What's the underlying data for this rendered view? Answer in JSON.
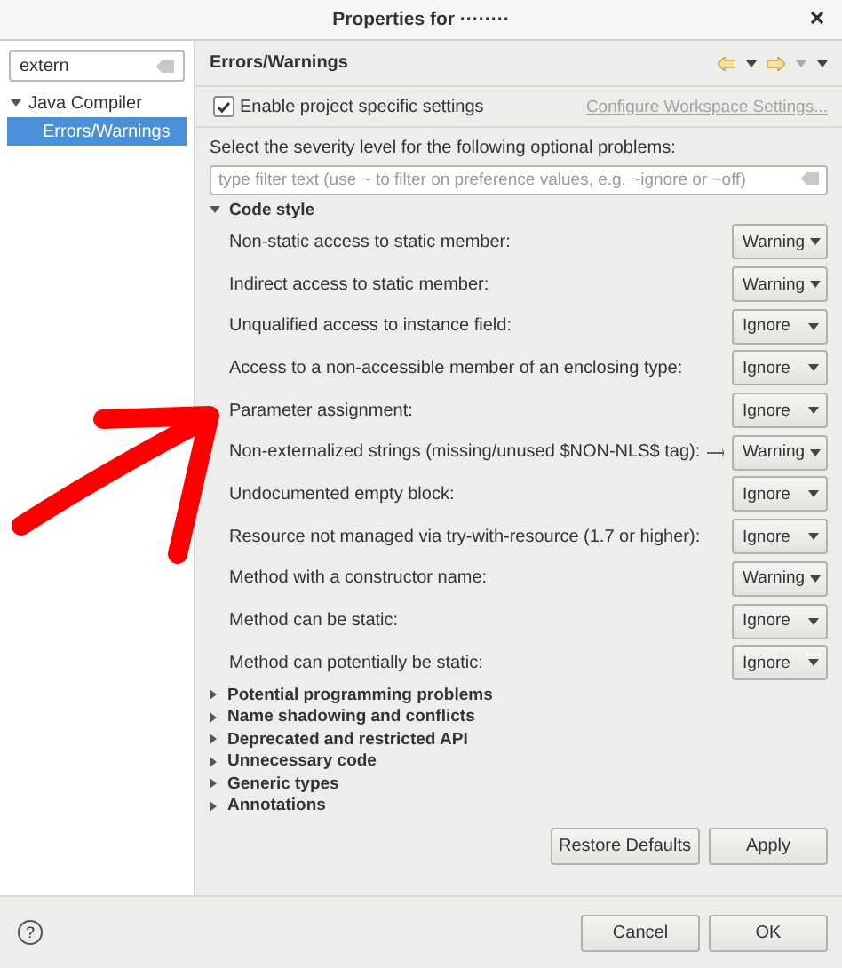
{
  "window": {
    "title": "Properties for ········"
  },
  "sidebar": {
    "filter": {
      "value": "extern"
    },
    "items": [
      {
        "label": "Java Compiler",
        "expanded": true,
        "selected": false,
        "children": [
          {
            "label": "Errors/Warnings",
            "selected": true
          }
        ]
      }
    ]
  },
  "page": {
    "title": "Errors/Warnings",
    "enable": {
      "label": "Enable project specific settings",
      "checked": true
    },
    "configure_link": "Configure Workspace Settings...",
    "description": "Select the severity level for the following optional problems:",
    "filter": {
      "placeholder": "type filter text (use ~ to filter on preference values, e.g. ~ignore or ~off)"
    },
    "sections": [
      {
        "label": "Code style",
        "expanded": true,
        "rows": [
          {
            "label": "Non-static access to static member:",
            "value": "Warning",
            "pointer": false
          },
          {
            "label": "Indirect access to static member:",
            "value": "Warning",
            "pointer": false
          },
          {
            "label": "Unqualified access to instance field:",
            "value": "Ignore",
            "pointer": false
          },
          {
            "label": "Access to a non-accessible member of an enclosing type:",
            "value": "Ignore",
            "pointer": false
          },
          {
            "label": "Parameter assignment:",
            "value": "Ignore",
            "pointer": false
          },
          {
            "label": "Non-externalized strings (missing/unused $NON-NLS$ tag):",
            "value": "Warning",
            "pointer": true
          },
          {
            "label": "Undocumented empty block:",
            "value": "Ignore",
            "pointer": false
          },
          {
            "label": "Resource not managed via try-with-resource (1.7 or higher):",
            "value": "Ignore",
            "pointer": false
          },
          {
            "label": "Method with a constructor name:",
            "value": "Warning",
            "pointer": false
          },
          {
            "label": "Method can be static:",
            "value": "Ignore",
            "pointer": false
          },
          {
            "label": "Method can potentially be static:",
            "value": "Ignore",
            "pointer": false
          }
        ]
      },
      {
        "label": "Potential programming problems",
        "expanded": false
      },
      {
        "label": "Name shadowing and conflicts",
        "expanded": false
      },
      {
        "label": "Deprecated and restricted API",
        "expanded": false
      },
      {
        "label": "Unnecessary code",
        "expanded": false
      },
      {
        "label": "Generic types",
        "expanded": false
      },
      {
        "label": "Annotations",
        "expanded": false
      }
    ],
    "buttons": [
      "Restore Defaults",
      "Apply"
    ]
  },
  "footer": {
    "help": "?",
    "buttons": [
      "Cancel",
      "OK"
    ]
  },
  "annotation": {
    "shown": true
  }
}
